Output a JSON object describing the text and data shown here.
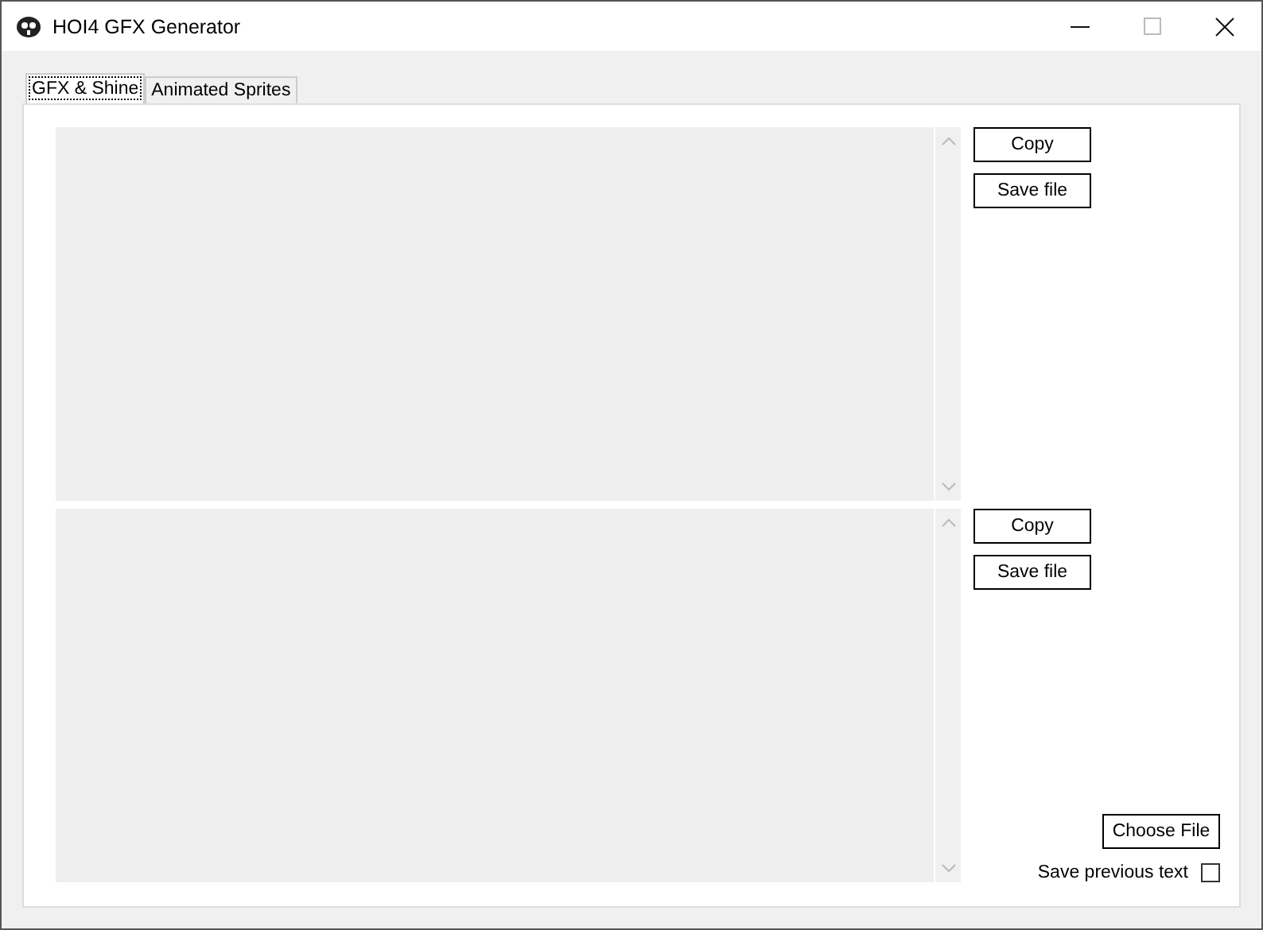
{
  "window": {
    "title": "HOI4 GFX Generator"
  },
  "tabs": [
    {
      "label": "GFX & Shine",
      "selected": true
    },
    {
      "label": "Animated Sprites",
      "selected": false
    }
  ],
  "editors": [
    {
      "buttons": [
        "Copy",
        "Save file"
      ]
    },
    {
      "buttons": [
        "Copy",
        "Save file"
      ]
    }
  ],
  "choose_file_button": "Choose File",
  "save_previous": {
    "label": "Save previous text",
    "checked": false
  }
}
